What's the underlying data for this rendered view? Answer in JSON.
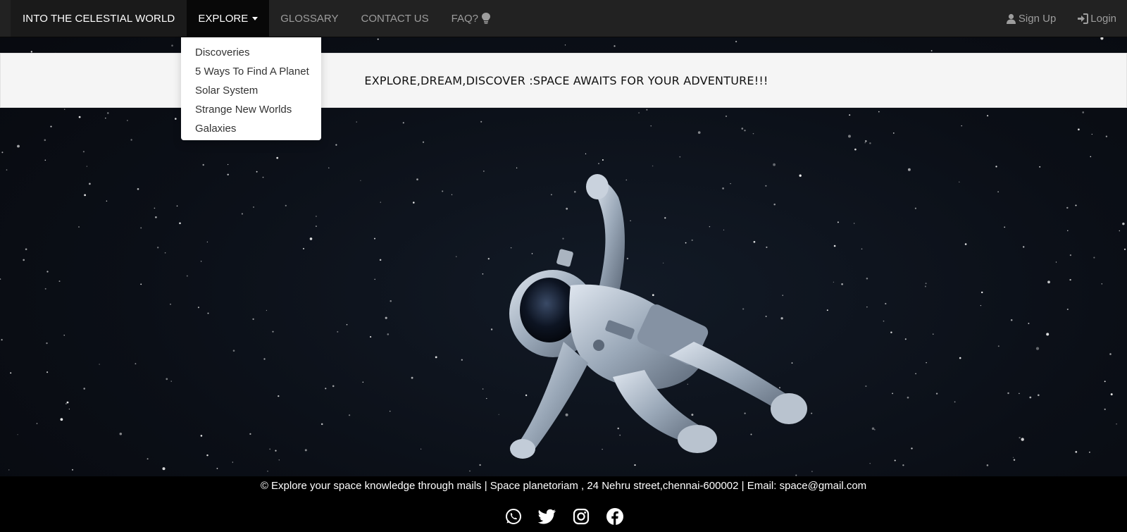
{
  "navbar": {
    "brand": "INTO THE CELESTIAL WORLD",
    "items": [
      {
        "label": "EXPLORE",
        "active": true,
        "dropdown": true
      },
      {
        "label": "GLOSSARY"
      },
      {
        "label": "CONTACT US"
      },
      {
        "label": "FAQ?",
        "icon": "lightbulb-icon"
      }
    ],
    "right": [
      {
        "label": "Sign Up",
        "icon": "user-icon"
      },
      {
        "label": "Login",
        "icon": "login-icon"
      }
    ]
  },
  "dropdown": {
    "items": [
      "Discoveries",
      "5 Ways To Find A Planet",
      "Solar System",
      "Strange New Worlds",
      "Galaxies"
    ]
  },
  "banner": {
    "text": "EXPLORE,DREAM,DISCOVER :SPACE AWAITS FOR YOUR ADVENTURE!!!"
  },
  "hero": {
    "image": "astronaut-floating-in-space"
  },
  "footer": {
    "text": "© Explore your space knowledge through mails | Space planetoriam , 24 Nehru street,chennai-600002 | Email: space@gmail.com",
    "socials": [
      "whatsapp-icon",
      "twitter-icon",
      "instagram-icon",
      "facebook-icon"
    ]
  },
  "colors": {
    "navbar_bg": "#222222",
    "nav_active_bg": "#080808",
    "nav_text": "#9d9d9d",
    "banner_bg": "#f5f5f5",
    "footer_bg": "#000000"
  }
}
